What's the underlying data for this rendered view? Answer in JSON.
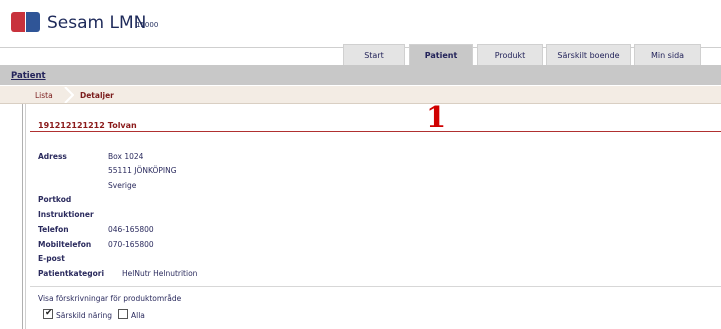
{
  "header": {
    "app_name": "Sesam LMN",
    "app_code": "15000"
  },
  "tabs": [
    {
      "label": "Start",
      "active": false
    },
    {
      "label": "Patient",
      "active": true
    },
    {
      "label": "Produkt",
      "active": false
    },
    {
      "label": "Särskilt boende",
      "active": false
    },
    {
      "label": "Min sida",
      "active": false
    }
  ],
  "page_title": "Patient",
  "breadcrumb": [
    "Lista",
    "Detaljer"
  ],
  "patient": {
    "id": "191212121212",
    "name": "Tolvan"
  },
  "annotation_marker": "1",
  "details": {
    "adress_label": "Adress",
    "adress_line1": "Box 1024",
    "adress_line2": "55111 JÖNKÖPING",
    "adress_line3": "Sverige",
    "portkod_label": "Portkod",
    "instruktioner_label": "Instruktioner",
    "telefon_label": "Telefon",
    "telefon_value": "046-165800",
    "mobil_label": "Mobiltelefon",
    "mobil_value": "070-165800",
    "epost_label": "E-post",
    "kategori_label": "Patientkategori",
    "kategori_value": "HelNutr Helnutrition"
  },
  "filter": {
    "heading": "Visa förskrivningar för produktområde",
    "options": [
      {
        "label": "Särskild näring",
        "checked": true
      },
      {
        "label": "Alla",
        "checked": false
      }
    ]
  },
  "colors": {
    "accent_red": "#8b1a1a",
    "navy": "#23235a",
    "tab_bg": "#e4e4e4",
    "nav_bg": "#c8c8c8"
  }
}
